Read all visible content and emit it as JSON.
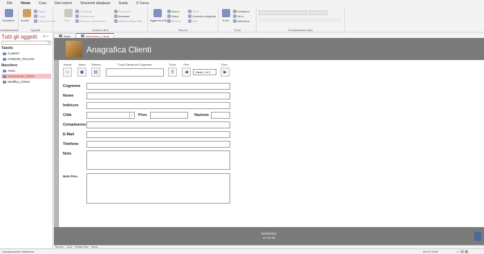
{
  "menu": {
    "tabs": [
      "File",
      "Home",
      "Crea",
      "Dati esterni",
      "Strumenti database",
      "Guida"
    ],
    "search": "Cerca"
  },
  "ribbon": {
    "views": {
      "label": "Visualizza",
      "group": "Visualizzazioni"
    },
    "clipboard": {
      "paste": "Incolla",
      "cut": "Taglia",
      "copy": "Copia",
      "format": "Copia formato",
      "group": "Appunti"
    },
    "sort": {
      "filter": "Filtro",
      "asc": "Crescente",
      "desc": "Decrescente",
      "remove": "Rimuovi ordinamento",
      "selection": "Selezione",
      "advanced": "Avanzate",
      "toggle": "Attiva/Disattiva filtro",
      "group": "Ordina e filtra"
    },
    "records": {
      "refresh": "Aggiorna tutto",
      "new": "Nuovo",
      "save": "Salva",
      "delete": "Elimina",
      "totals": "Totali",
      "spelling": "Controllo ortografia",
      "more": "Altro",
      "group": "Record"
    },
    "find": {
      "find": "Trova",
      "replace": "Sostituisci",
      "goto": "Vai a",
      "select": "Seleziona",
      "group": "Trova"
    },
    "text": {
      "group": "Formattazione testo"
    }
  },
  "nav": {
    "title": "Tutti gli oggetti",
    "sections": [
      {
        "name": "Tabelle",
        "items": [
          "CLIENTI",
          "COMUNI_ITALIANI"
        ]
      },
      {
        "name": "Maschere",
        "items": [
          "Avvio",
          "Inserimento_Clienti",
          "Modifica_Clienti"
        ]
      }
    ],
    "selected": "Inserimento_Clienti"
  },
  "doctabs": [
    "Avvio",
    "Inserimento_Clienti"
  ],
  "form": {
    "title": "Anagrafica Clienti",
    "toolbar": {
      "new": "Nuova",
      "save": "Salva",
      "delete": "Elimina",
      "search_label": "Trova Cliente per Cognome",
      "find": "Trova",
      "prev": "Prec.",
      "counter": "Clienti 1 di 3",
      "next": "Succ."
    },
    "fields": {
      "cognome": "Cognome",
      "nome": "Nome",
      "indirizzo": "Indirizzo",
      "citta": "Città",
      "prov": "Prov.",
      "nazione": "Nazione",
      "compleanno": "Compleanno",
      "email": "E-Mail",
      "telefono": "Telefono",
      "note": "Note",
      "note_prec": "Note Prec."
    },
    "footer": {
      "date": "08/09/2021",
      "time": "14:40:49"
    }
  },
  "recnav": {
    "record": "Record:",
    "filter": "Nessun filtro",
    "search": "Cerca"
  },
  "status": {
    "left": "Visualizzazione Maschera",
    "right": "BLOC NUM"
  }
}
